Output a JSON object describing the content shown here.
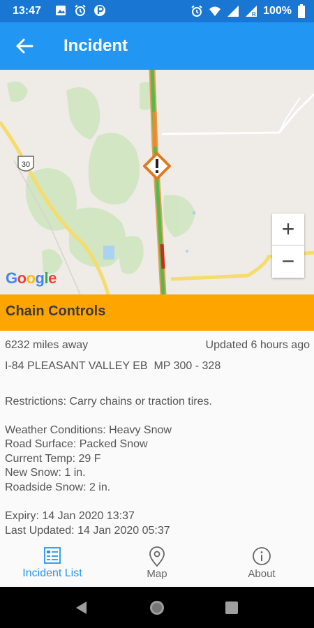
{
  "status_bar": {
    "time": "13:47",
    "battery": "100%",
    "left_icons": [
      "image-icon",
      "alarm-icon",
      "parking-icon"
    ],
    "right_icons": [
      "alarm-icon",
      "wifi-icon",
      "signal-icon",
      "roaming-signal-icon",
      "battery-icon"
    ]
  },
  "app_bar": {
    "title": "Incident",
    "back_icon": "arrow-left-icon",
    "color": "#2196F3"
  },
  "map": {
    "route_shield": "30",
    "zoom_in": "+",
    "zoom_out": "−",
    "attribution": {
      "G": "G",
      "o1": "o",
      "o2": "o",
      "g": "g",
      "l": "l",
      "e": "e"
    },
    "incident_marker_icon": "warning-diamond-icon"
  },
  "incident": {
    "type": "Chain Controls",
    "banner_color": "#FFA500",
    "distance": "6232 miles away",
    "updated": "Updated 6 hours ago",
    "location": "I-84 PLEASANT VALLEY EB  MP 300 - 328",
    "restrictions": "Restrictions: Carry chains or traction tires.",
    "weather": "Weather Conditions: Heavy Snow",
    "road_surface": "Road Surface: Packed Snow",
    "current_temp": "Current Temp: 29 F",
    "new_snow": "New Snow: 1 in.",
    "roadside_snow": "Roadside Snow: 2 in.",
    "expiry": "Expiry: 14 Jan 2020 13:37",
    "last_updated": "Last Updated: 14 Jan 2020 05:37"
  },
  "bottom_nav": {
    "items": [
      {
        "label": "Incident List",
        "icon": "list-icon",
        "active": true
      },
      {
        "label": "Map",
        "icon": "map-pin-icon",
        "active": false
      },
      {
        "label": "About",
        "icon": "info-icon",
        "active": false
      }
    ]
  },
  "system_nav": {
    "back": "back-triangle-icon",
    "home": "home-circle-icon",
    "recents": "recents-square-icon"
  }
}
